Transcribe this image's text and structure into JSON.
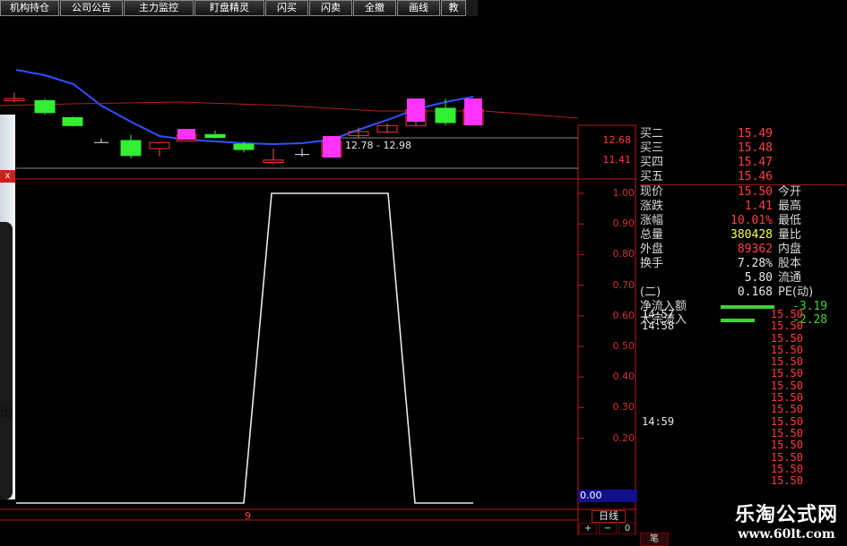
{
  "toolbar": [
    "机构持仓",
    "公司公告",
    "主力监控",
    "盯盘精灵",
    "闪买",
    "闪卖",
    "全撤",
    "画线",
    "教"
  ],
  "price_axis": [
    "12.68",
    "11.41"
  ],
  "range_label": "12.78 - 12.98",
  "indicator_axis": [
    "1.00",
    "0.90",
    "0.80",
    "0.70",
    "0.60",
    "0.50",
    "0.40",
    "0.30",
    "0.20"
  ],
  "indicator_current": "0.00",
  "period_marker": "9",
  "period_label": "日线",
  "zoom_controls": [
    "+",
    "−",
    "0"
  ],
  "bottom_tab": "笔",
  "left_overlay": {
    "close": "x",
    "char": "出"
  },
  "quote": {
    "asks": [
      {
        "label": "买二",
        "value": "15.49"
      },
      {
        "label": "买三",
        "value": "15.48"
      },
      {
        "label": "买四",
        "value": "15.47"
      },
      {
        "label": "买五",
        "value": "15.46"
      }
    ],
    "stats": [
      {
        "label": "现价",
        "value": "15.50",
        "label2": "今开",
        "color": "red"
      },
      {
        "label": "涨跌",
        "value": "1.41",
        "label2": "最高",
        "color": "red"
      },
      {
        "label": "涨幅",
        "value": "10.01%",
        "label2": "最低",
        "color": "red"
      },
      {
        "label": "总量",
        "value": "380428",
        "label2": "量比",
        "color": "yellow"
      },
      {
        "label": "外盘",
        "value": "89362",
        "label2": "内盘",
        "color": "red"
      },
      {
        "label": "换手",
        "value": "7.28%",
        "label2": "股本",
        "color": "white"
      },
      {
        "label": "",
        "value": "5.80",
        "label2": "流通",
        "color": "white"
      },
      {
        "label": "(二)",
        "value": "0.168",
        "label2": "PE(动)",
        "color": "white"
      }
    ],
    "flows": [
      {
        "label": "净流入额",
        "value": "-3.19"
      },
      {
        "label": "大宗流入",
        "value": "-2.28"
      }
    ]
  },
  "ticks": [
    {
      "time": "14:57",
      "price": "15.50"
    },
    {
      "time": "14:58",
      "price": "15.50"
    },
    {
      "time": "",
      "price": "15.50"
    },
    {
      "time": "",
      "price": "15.50"
    },
    {
      "time": "",
      "price": "15.50"
    },
    {
      "time": "",
      "price": "15.50"
    },
    {
      "time": "",
      "price": "15.50"
    },
    {
      "time": "",
      "price": "15.50"
    },
    {
      "time": "",
      "price": "15.50"
    },
    {
      "time": "14:59",
      "price": "15.50"
    },
    {
      "time": "",
      "price": "15.50"
    },
    {
      "time": "",
      "price": "15.50"
    },
    {
      "time": "",
      "price": "15.50"
    },
    {
      "time": "",
      "price": "15.50"
    },
    {
      "time": "",
      "price": "15.50"
    }
  ],
  "watermark": {
    "title": "乐淘公式网",
    "url": "www.60lt.com"
  },
  "colors": {
    "up": "#ff33ff",
    "down": "#33ee33",
    "axis": "#c01818",
    "ma": "#3050ff",
    "ma2": "#b02020"
  },
  "candles": [
    {
      "c": "up",
      "o": 14.8,
      "cl": 14.9,
      "h": 15.2,
      "l": 14.7
    },
    {
      "c": "down",
      "o": 14.8,
      "cl": 14.2,
      "h": 14.9,
      "l": 14.1
    },
    {
      "c": "down",
      "o": 13.95,
      "cl": 13.55,
      "h": 14.0,
      "l": 13.5
    },
    {
      "c": "flat",
      "o": 12.7,
      "cl": 12.7,
      "h": 12.9,
      "l": 12.7
    },
    {
      "c": "down",
      "o": 12.8,
      "cl": 12.05,
      "h": 13.1,
      "l": 11.9
    },
    {
      "c": "up",
      "o": 12.4,
      "cl": 12.7,
      "h": 12.72,
      "l": 12.0
    },
    {
      "c": "up",
      "o": 12.78,
      "cl": 13.08,
      "h": 13.1,
      "l": 12.74
    },
    {
      "c": "down",
      "o": 13.1,
      "cl": 12.95,
      "h": 13.3,
      "l": 12.9
    },
    {
      "c": "down",
      "o": 12.62,
      "cl": 12.35,
      "h": 12.75,
      "l": 12.2
    },
    {
      "c": "up",
      "o": 11.7,
      "cl": 11.82,
      "h": 12.4,
      "l": 11.6
    },
    {
      "c": "flat",
      "o": 12.1,
      "cl": 12.1,
      "h": 12.4,
      "l": 12.0
    },
    {
      "c": "up",
      "o": 12.0,
      "cl": 12.75,
      "h": 12.8,
      "l": 11.98
    },
    {
      "c": "up",
      "o": 13.05,
      "cl": 13.25,
      "h": 13.45,
      "l": 12.9
    },
    {
      "c": "up",
      "o": 13.22,
      "cl": 13.55,
      "h": 13.65,
      "l": 13.2
    },
    {
      "c": "up",
      "o": 13.55,
      "cl": 14.35,
      "h": 14.42,
      "l": 13.55
    },
    {
      "c": "down",
      "o": 14.42,
      "cl": 13.7,
      "h": 14.9,
      "l": 13.55
    },
    {
      "c": "up",
      "o": 13.6,
      "cl": 14.35,
      "h": 14.45,
      "l": 13.55
    }
  ],
  "indicator_series": [
    0,
    0,
    0,
    0,
    0,
    0,
    0,
    0,
    0,
    0,
    0,
    1,
    1,
    1,
    1,
    1,
    0,
    0,
    0,
    0
  ]
}
